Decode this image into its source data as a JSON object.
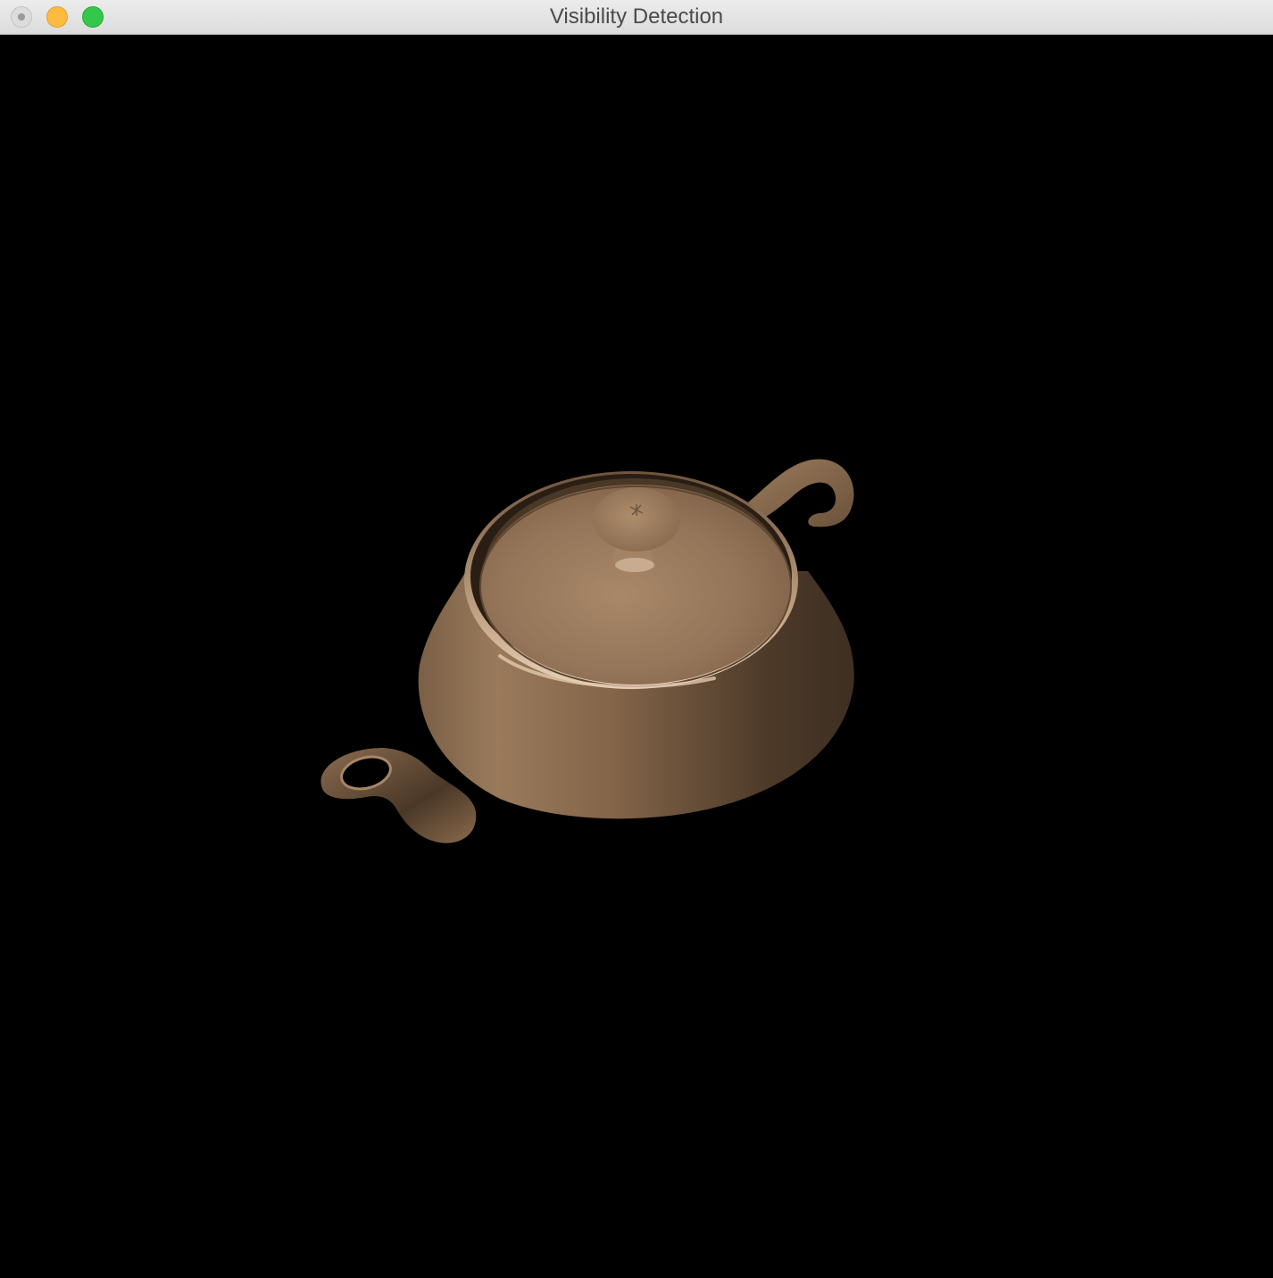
{
  "window": {
    "title": "Visibility Detection",
    "controls": {
      "close": "close-button",
      "minimize": "minimize-button",
      "maximize": "maximize-button"
    }
  },
  "scene": {
    "background_color": "#000000",
    "object": "teapot",
    "material_color": "#8d6e52",
    "parts": [
      "body",
      "lid",
      "knob",
      "handle",
      "spout"
    ]
  }
}
